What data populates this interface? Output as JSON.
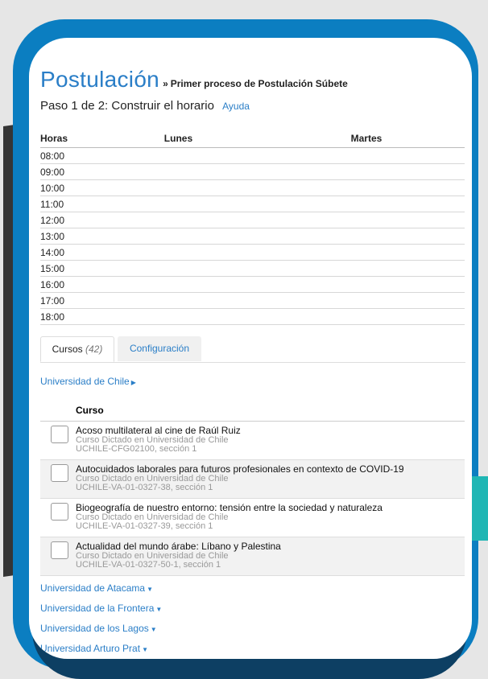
{
  "page": {
    "title": "Postulación",
    "title_sep": "»",
    "subtitle": "Primer proceso de Postulación Súbete",
    "step": "Paso 1 de 2: Construir el horario",
    "help": "Ayuda"
  },
  "schedule": {
    "headers": [
      "Horas",
      "Lunes",
      "Martes"
    ],
    "hours": [
      "08:00",
      "09:00",
      "10:00",
      "11:00",
      "12:00",
      "13:00",
      "14:00",
      "15:00",
      "16:00",
      "17:00",
      "18:00"
    ]
  },
  "tabs": {
    "courses_label": "Cursos",
    "courses_count": "(42)",
    "config_label": "Configuración"
  },
  "university_selected": "Universidad de Chile",
  "courses": {
    "header": "Curso",
    "items": [
      {
        "name": "Acoso multilateral al cine de Raúl Ruiz",
        "meta": "Curso Dictado en Universidad de Chile",
        "code": "UCHILE-CFG02100, sección 1"
      },
      {
        "name": "Autocuidados laborales para futuros profesionales en contexto de COVID-19",
        "meta": "Curso Dictado en Universidad de Chile",
        "code": "UCHILE-VA-01-0327-38, sección 1"
      },
      {
        "name": "Biogeografía de nuestro entorno: tensión entre la sociedad y naturaleza",
        "meta": "Curso Dictado en Universidad de Chile",
        "code": "UCHILE-VA-01-0327-39, sección 1"
      },
      {
        "name": "Actualidad del mundo árabe: Líbano y Palestina",
        "meta": "Curso Dictado en Universidad de Chile",
        "code": "UCHILE-VA-01-0327-50-1, sección 1"
      }
    ]
  },
  "other_universities": [
    "Universidad de Atacama",
    "Universidad de la Frontera",
    "Universidad de los Lagos",
    "Universidad Arturo Prat"
  ],
  "colors": {
    "accent": "#2a7ec7",
    "frame_blue": "#0b7ec1",
    "frame_navy": "#0d3f63",
    "teal": "#1fb6b4"
  },
  "icons": {
    "caret_right": "caret-right-icon",
    "caret_down": "caret-down-icon"
  }
}
